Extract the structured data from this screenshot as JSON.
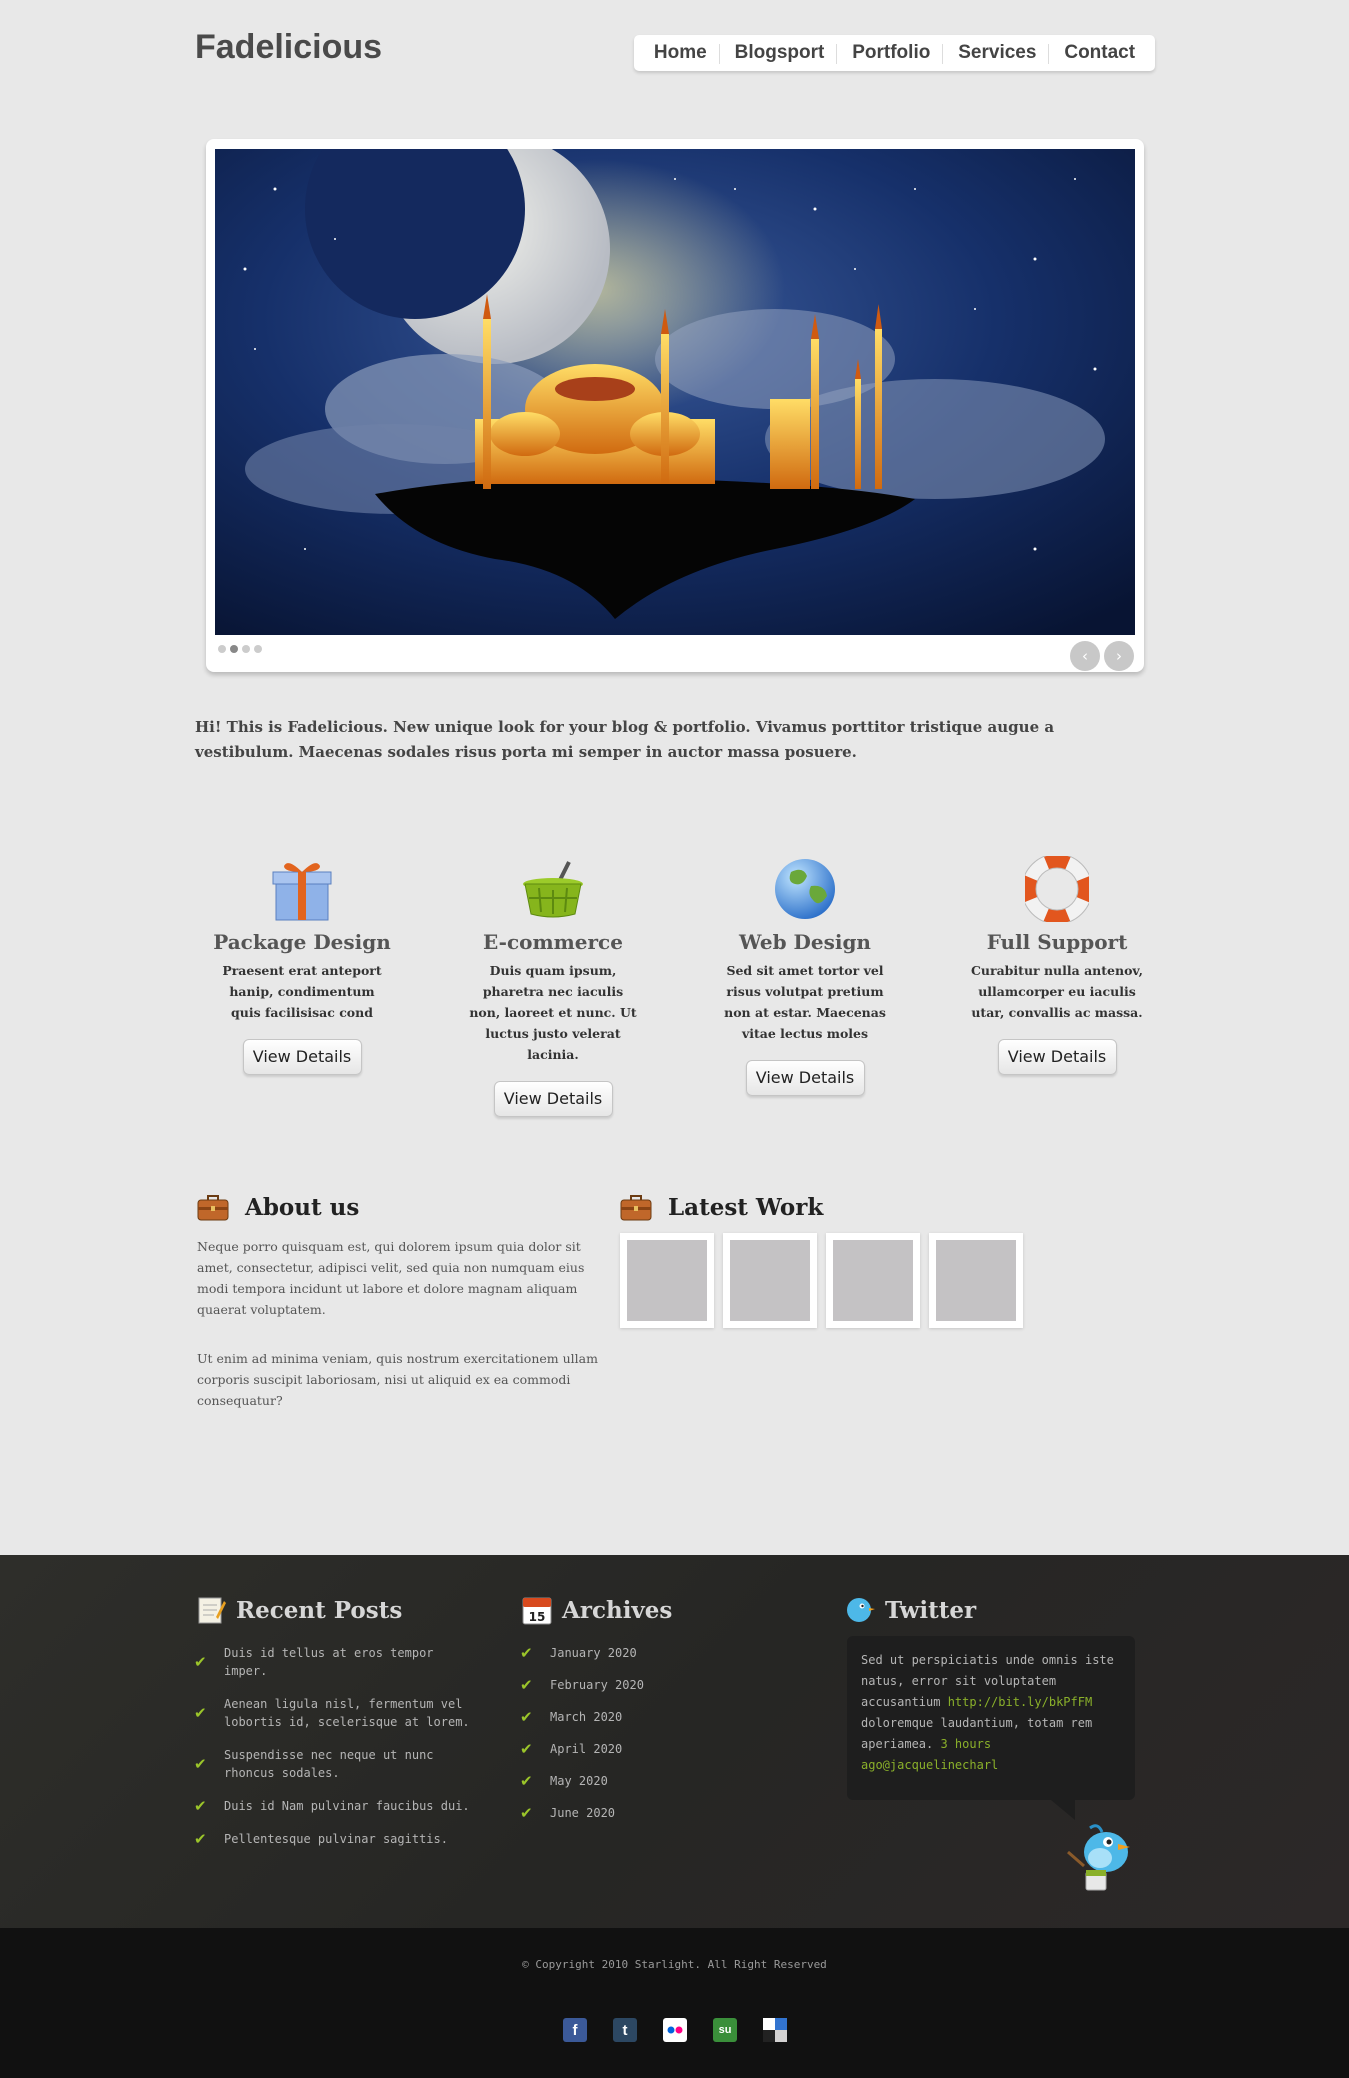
{
  "header": {
    "logo": "Fadelicious",
    "nav": [
      "Home",
      "Blogsport",
      "Portfolio",
      "Services",
      "Contact"
    ]
  },
  "slider": {
    "image": "floating-mosque-night-moon",
    "active_dot": 2,
    "dot_count": 4,
    "prev_icon": "chevron-left-icon",
    "next_icon": "chevron-right-icon"
  },
  "intro": {
    "text": "Hi! This is Fadelicious. New unique look for your blog & portfolio. Vivamus porttitor tristique augue a vestibulum. Maecenas sodales risus porta mi semper in auctor massa posuere."
  },
  "services": [
    {
      "icon": "gift-icon",
      "title": "Package Design",
      "text": "Praesent erat anteport hanip, condimentum quis facilisisac cond",
      "button": "View Details"
    },
    {
      "icon": "basket-icon",
      "title": "E-commerce",
      "text": "Duis quam ipsum, pharetra nec iaculis non, laoreet et nunc. Ut luctus justo velerat lacinia.",
      "button": "View Details"
    },
    {
      "icon": "globe-icon",
      "title": "Web Design",
      "text": "Sed sit amet tortor vel risus volutpat pretium non at estar. Maecenas vitae lectus moles",
      "button": "View Details"
    },
    {
      "icon": "lifebuoy-icon",
      "title": "Full Support",
      "text": "Curabitur nulla antenov, ullamcorper eu iaculis utar, convallis ac massa.",
      "button": "View Details"
    }
  ],
  "about": {
    "title": "About us",
    "p1": "Neque porro quisquam est, qui dolorem ipsum quia dolor sit amet, consectetur, adipisci velit, sed quia non numquam eius modi tempora incidunt ut labore et dolore magnam aliquam quaerat voluptatem.",
    "p2": "Ut enim ad minima veniam, quis nostrum exercitationem ullam corporis suscipit laboriosam, nisi ut aliquid ex ea commodi consequatur?"
  },
  "latest_work": {
    "title": "Latest Work",
    "thumb_count": 4
  },
  "footer": {
    "recent_posts": {
      "title": "Recent Posts",
      "items": [
        "Duis id tellus at eros tempor imper.",
        "Aenean ligula nisl, fermentum vel lobortis id, scelerisque at lorem.",
        "Suspendisse nec neque ut nunc rhoncus sodales.",
        "Duis id Nam pulvinar faucibus dui.",
        "Pellentesque pulvinar sagittis."
      ]
    },
    "archives": {
      "title": "Archives",
      "calendar_day": "15",
      "items": [
        "January 2020",
        "February 2020",
        "March 2020",
        "April 2020",
        "May 2020",
        "June 2020"
      ]
    },
    "twitter": {
      "title": "Twitter",
      "text1": "Sed ut perspiciatis unde omnis iste natus, error sit voluptatem accusantium ",
      "link": "http://bit.ly/bkPfFM",
      "text2": " doloremque laudantium, totam rem aperiamea. ",
      "meta": "3 hours ago@jacquelinecharl"
    },
    "copyright": "© Copyright 2010 Starlight. All Right Reserved",
    "socials": [
      {
        "icon": "facebook-icon",
        "glyph": "f",
        "color": "#3b5998"
      },
      {
        "icon": "tumblr-icon",
        "glyph": "t",
        "color": "#2c4762"
      },
      {
        "icon": "flickr-icon",
        "glyph": "",
        "color": "#ffffff"
      },
      {
        "icon": "stumbleupon-icon",
        "glyph": "su",
        "color": "#3a8f3a"
      },
      {
        "icon": "delicious-icon",
        "glyph": "",
        "color": "#ffffff"
      }
    ]
  }
}
